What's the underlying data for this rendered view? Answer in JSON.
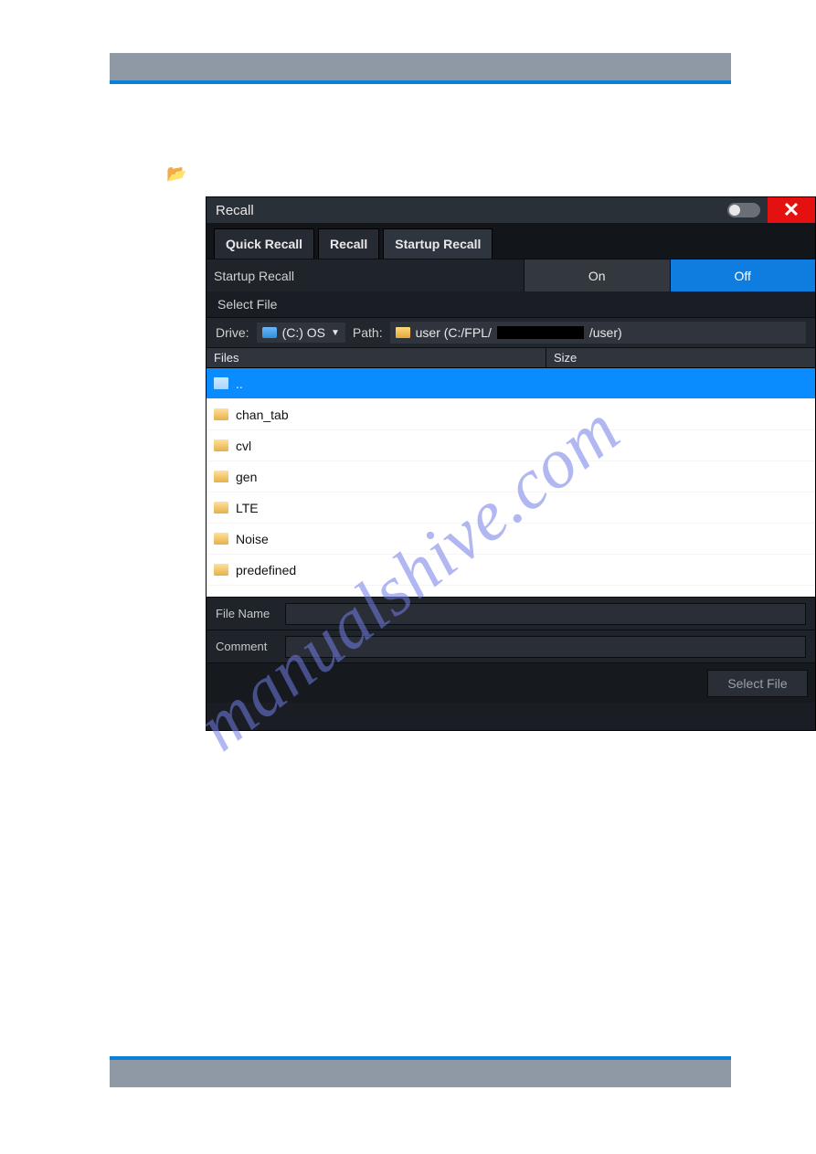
{
  "watermark": "manualshive.com",
  "dialog": {
    "title": "Recall",
    "close_glyph": "✕",
    "tabs": [
      "Quick Recall",
      "Recall",
      "Startup Recall"
    ],
    "active_tab_index": 2,
    "startup_recall_label": "Startup Recall",
    "on_label": "On",
    "off_label": "Off",
    "select_file_title": "Select File",
    "drive_label": "Drive:",
    "drive_value": "(C:) OS",
    "path_label": "Path:",
    "path_prefix": "user (C:/FPL/",
    "path_suffix": "/user)",
    "files_header": "Files",
    "size_header": "Size",
    "files": [
      "..",
      "chan_tab",
      "cvl",
      "gen",
      "LTE",
      "Noise",
      "predefined"
    ],
    "file_name_label": "File Name",
    "comment_label": "Comment",
    "file_name_value": "",
    "comment_value": "",
    "select_file_button": "Select File"
  }
}
